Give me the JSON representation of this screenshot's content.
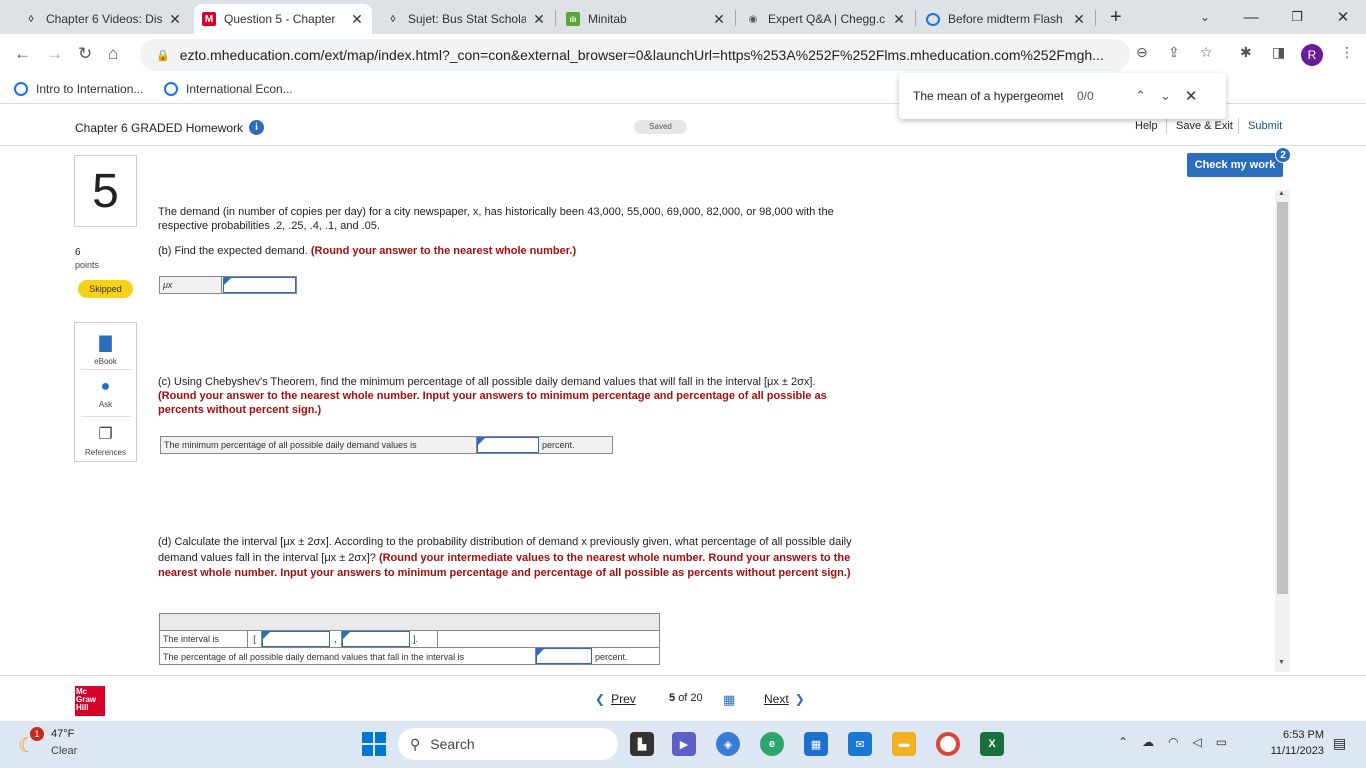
{
  "browser": {
    "tabs": [
      {
        "title": "Chapter 6 Videos: Dis",
        "icon": "D",
        "icon_color": "#444"
      },
      {
        "title": "Question 5 - Chapter",
        "icon": "M",
        "icon_color": "#d6002a"
      },
      {
        "title": "Sujet: Bus Stat Schola",
        "icon": "D",
        "icon_color": "#444"
      },
      {
        "title": "Minitab",
        "icon": "ılı",
        "icon_color": "#5aa832"
      },
      {
        "title": "Expert Q&A | Chegg.c",
        "icon": "◉",
        "icon_color": "#555"
      },
      {
        "title": "Before midterm Flash",
        "icon": "Q",
        "icon_color": "#1a73e8"
      }
    ],
    "url": "ezto.mheducation.com/ext/map/index.html?_con=con&external_browser=0&launchUrl=https%253A%252F%252Flms.mheducation.com%252Fmgh...",
    "profile_initial": "R",
    "bookmarks": [
      "Intro to Internation...",
      "International Econ..."
    ],
    "find": {
      "query": "The mean of a hypergeomet",
      "count": "0/0"
    }
  },
  "header": {
    "title": "Chapter 6 GRADED Homework",
    "saved": "Saved",
    "help": "Help",
    "save_exit": "Save & Exit",
    "submit": "Submit"
  },
  "check_work": {
    "label": "Check my work",
    "badge": "2"
  },
  "question": {
    "number": "5",
    "points": "6",
    "points_label": "points",
    "status": "Skipped",
    "tools": [
      "eBook",
      "Ask",
      "References"
    ],
    "intro": "The demand (in number of copies per day) for a city newspaper, x, has historically been 43,000, 55,000, 69,000, 82,000, or 98,000 with the respective probabilities .2, .25, .4, .1, and .05.",
    "b_prompt": "(b) Find the expected demand.",
    "b_instruction": "(Round your answer to the nearest whole number.)",
    "b_label": "μx",
    "c_prompt": "(c) Using Chebyshev's Theorem, find the minimum percentage of all possible daily demand values that will fall in the interval [μx ± 2σx].",
    "c_instruction": "(Round your answer to the nearest whole number. Input your answers to minimum percentage and percentage of all possible as percents without percent sign.)",
    "c_label": "The minimum percentage of all possible daily demand values is",
    "c_unit": "percent.",
    "d_prompt": "(d) Calculate the interval [μx ± 2σx]. According to the probability distribution of demand x previously given, what percentage of all possible daily demand values fall in the interval [μx ± 2σx]?",
    "d_instruction": "(Round your intermediate values to the nearest whole number. Round your answers to the nearest whole number. Input your answers to minimum percentage and percentage of all possible as percents without percent sign.)",
    "d_row1_label": "The interval is",
    "d_open": "[",
    "d_comma": ",",
    "d_close": "].",
    "d_row2_label": "The percentage of all possible daily demand values that fall in the interval is",
    "d_unit": "percent."
  },
  "footer": {
    "logo": "Mc Graw Hill",
    "prev": "Prev",
    "page": "5",
    "of": "of 20",
    "next": "Next"
  },
  "taskbar": {
    "weather_badge": "1",
    "temp": "47°F",
    "condition": "Clear",
    "search": "Search",
    "time": "6:53 PM",
    "date": "11/11/2023"
  }
}
